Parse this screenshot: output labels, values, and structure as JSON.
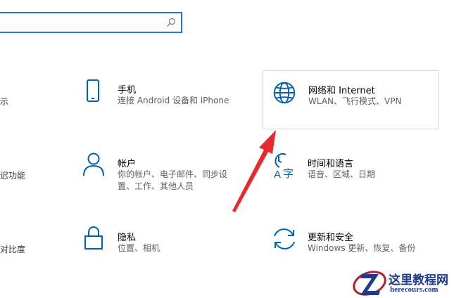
{
  "search": {
    "placeholder": ""
  },
  "left_clipped": [
    "示",
    "迟功能",
    "对比度"
  ],
  "tiles": [
    {
      "title": "手机",
      "subtitle": "连接 Android 设备和 iPhone",
      "icon": "phone-icon"
    },
    {
      "title": "网络和 Internet",
      "subtitle": "WLAN、飞行模式、VPN",
      "icon": "globe-icon"
    },
    {
      "title": "帐户",
      "subtitle_lines": [
        "你的帐户、电子邮件、同步设",
        "置、工作、其他人员"
      ],
      "icon": "person-icon"
    },
    {
      "title": "时间和语言",
      "subtitle": "语音、区域、日期",
      "icon": "time-language-icon"
    },
    {
      "title": "隐私",
      "subtitle": "位置、相机",
      "icon": "lock-icon"
    },
    {
      "title": "更新和安全",
      "subtitle": "Windows 更新、恢复、备份",
      "icon": "update-icon"
    }
  ],
  "watermark": {
    "cn": "这里教程网",
    "en": "herecours.com"
  },
  "colors": {
    "accent": "#0063b1",
    "arrow": "#e8282b",
    "watermark": "#1d3a8f"
  }
}
